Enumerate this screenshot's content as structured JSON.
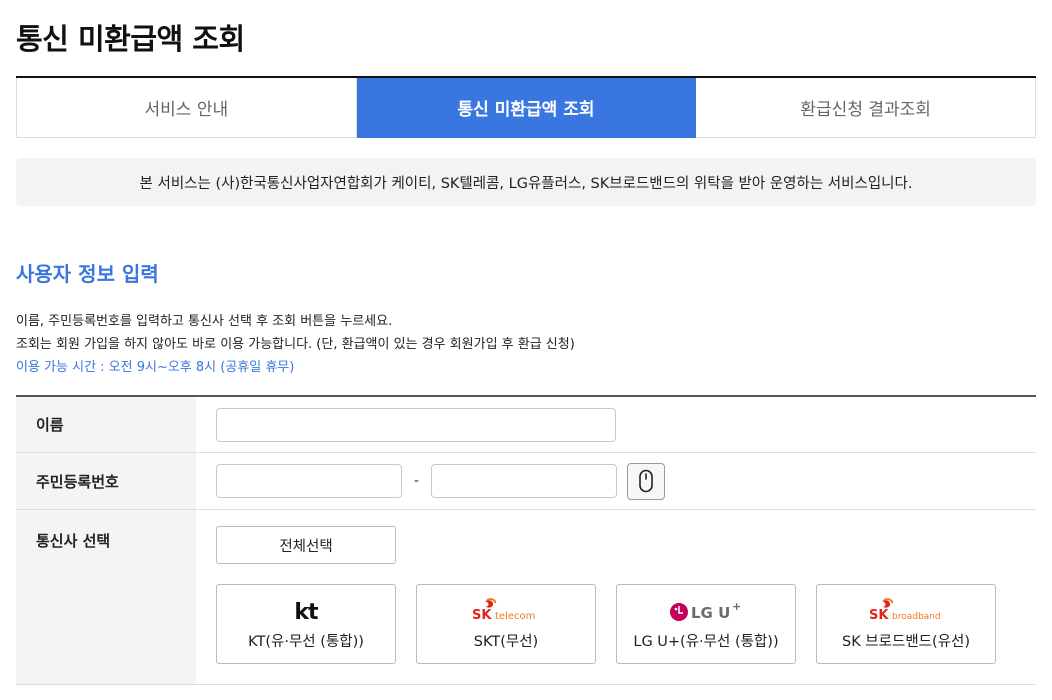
{
  "page": {
    "title": "통신 미환급액 조회"
  },
  "tabs": [
    {
      "label": "서비스 안내"
    },
    {
      "label": "통신 미환급액 조회"
    },
    {
      "label": "환급신청 결과조회"
    }
  ],
  "notice": "본 서비스는 (사)한국통신사업자연합회가 케이티, SK텔레콤, LG유플러스, SK브로드밴드의 위탁을 받아 운영하는 서비스입니다.",
  "section": {
    "title": "사용자 정보 입력",
    "help": [
      "이름, 주민등록번호를 입력하고 통신사 선택 후 조회 버튼을 누르세요.",
      "조회는 회원 가입을 하지 않아도 바로 이용 가능합니다. (단, 환급액이 있는 경우 회원가입 후 환급 신청)",
      "이용 가능 시간 : 오전 9시~오후 8시 (공휴일 휴무)"
    ]
  },
  "form": {
    "name_label": "이름",
    "name_value": "",
    "rrn_label": "주민등록번호",
    "rrn_front_value": "",
    "rrn_back_value": "",
    "rrn_separator": "-",
    "carrier_label": "통신사 선택",
    "select_all_label": "전체선택",
    "carriers": [
      {
        "logo_text": "kt",
        "name": "KT(유·무선 (통합))"
      },
      {
        "logo_text": "SK telecom",
        "name": "SKT(무선)"
      },
      {
        "logo_text": "LG U+",
        "name": "LG U+(유·무선 (통합))"
      },
      {
        "logo_text": "SK broadband",
        "name": "SK 브로드밴드(유선)"
      }
    ]
  },
  "icons": {
    "security_keypad": "mouse-icon"
  },
  "colors": {
    "accent": "#3a76e0",
    "sk_orange": "#f47920",
    "sk_red": "#e2231a",
    "lg_red": "#c4005a",
    "lg_gray": "#6b6b6b"
  }
}
